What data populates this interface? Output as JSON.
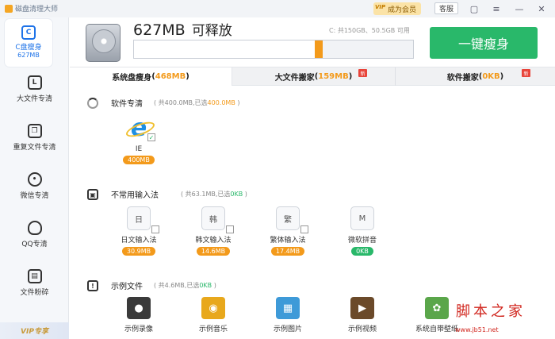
{
  "window": {
    "title": "磁盘清理大师",
    "vip_tag": "VIP",
    "vip_join": "成为会员",
    "service": "客服"
  },
  "sidebar": {
    "items": [
      {
        "label": "C盘瘦身",
        "sub": "627MB",
        "icon": "c-drive-icon"
      },
      {
        "label": "大文件专清",
        "icon": "large-file-icon"
      },
      {
        "label": "重复文件专清",
        "icon": "duplicate-file-icon"
      },
      {
        "label": "微信专清",
        "icon": "wechat-icon"
      },
      {
        "label": "QQ专清",
        "icon": "qq-icon"
      },
      {
        "label": "文件粉碎",
        "icon": "shredder-icon"
      }
    ],
    "vip_banner": "VIP专享"
  },
  "header": {
    "size": "627MB",
    "release_label": "可释放",
    "disk_info": "C: 共150GB、50.5GB 可用",
    "used_fraction": 0.66,
    "slim_button": "一键瘦身"
  },
  "tabs": [
    {
      "label": "系统盘瘦身",
      "count": "468MB",
      "active": true,
      "new": false
    },
    {
      "label": "大文件搬家",
      "count": "159MB",
      "active": false,
      "new": true,
      "new_text": "新"
    },
    {
      "label": "软件搬家",
      "count": "0KB",
      "active": false,
      "new": true,
      "new_text": "新"
    }
  ],
  "sections": [
    {
      "title": "软件专清",
      "total": "共400.0MB,已选",
      "selected": "400.0MB",
      "apps": [
        {
          "name": "IE",
          "size": "400MB",
          "icon": "ie-icon",
          "checked": true
        }
      ]
    },
    {
      "title": "不常用输入法",
      "total": "共63.1MB,已选",
      "selected": "0KB",
      "apps": [
        {
          "name": "日文输入法",
          "size": "30.9MB",
          "glyph": "日"
        },
        {
          "name": "韩文输入法",
          "size": "14.6MB",
          "glyph": "韩"
        },
        {
          "name": "繁体输入法",
          "size": "17.4MB",
          "glyph": "繁"
        },
        {
          "name": "微软拼音",
          "size": "0KB",
          "glyph": "M"
        }
      ]
    },
    {
      "title": "示例文件",
      "total": "共4.6MB,已选",
      "selected": "0KB",
      "apps": [
        {
          "name": "示例录像",
          "icon": "video-sample-icon",
          "color": "#3a3a3a"
        },
        {
          "name": "示例音乐",
          "icon": "music-sample-icon",
          "color": "#e8a81c"
        },
        {
          "name": "示例图片",
          "icon": "picture-sample-icon",
          "color": "#3e9ad8"
        },
        {
          "name": "示例视频",
          "icon": "film-sample-icon",
          "color": "#6b4a2a"
        },
        {
          "name": "系统自带壁纸",
          "icon": "wallpaper-icon",
          "color": "#5aa64a"
        }
      ]
    }
  ],
  "watermark": {
    "text": "脚本之家",
    "url": "www.jb51.net"
  }
}
